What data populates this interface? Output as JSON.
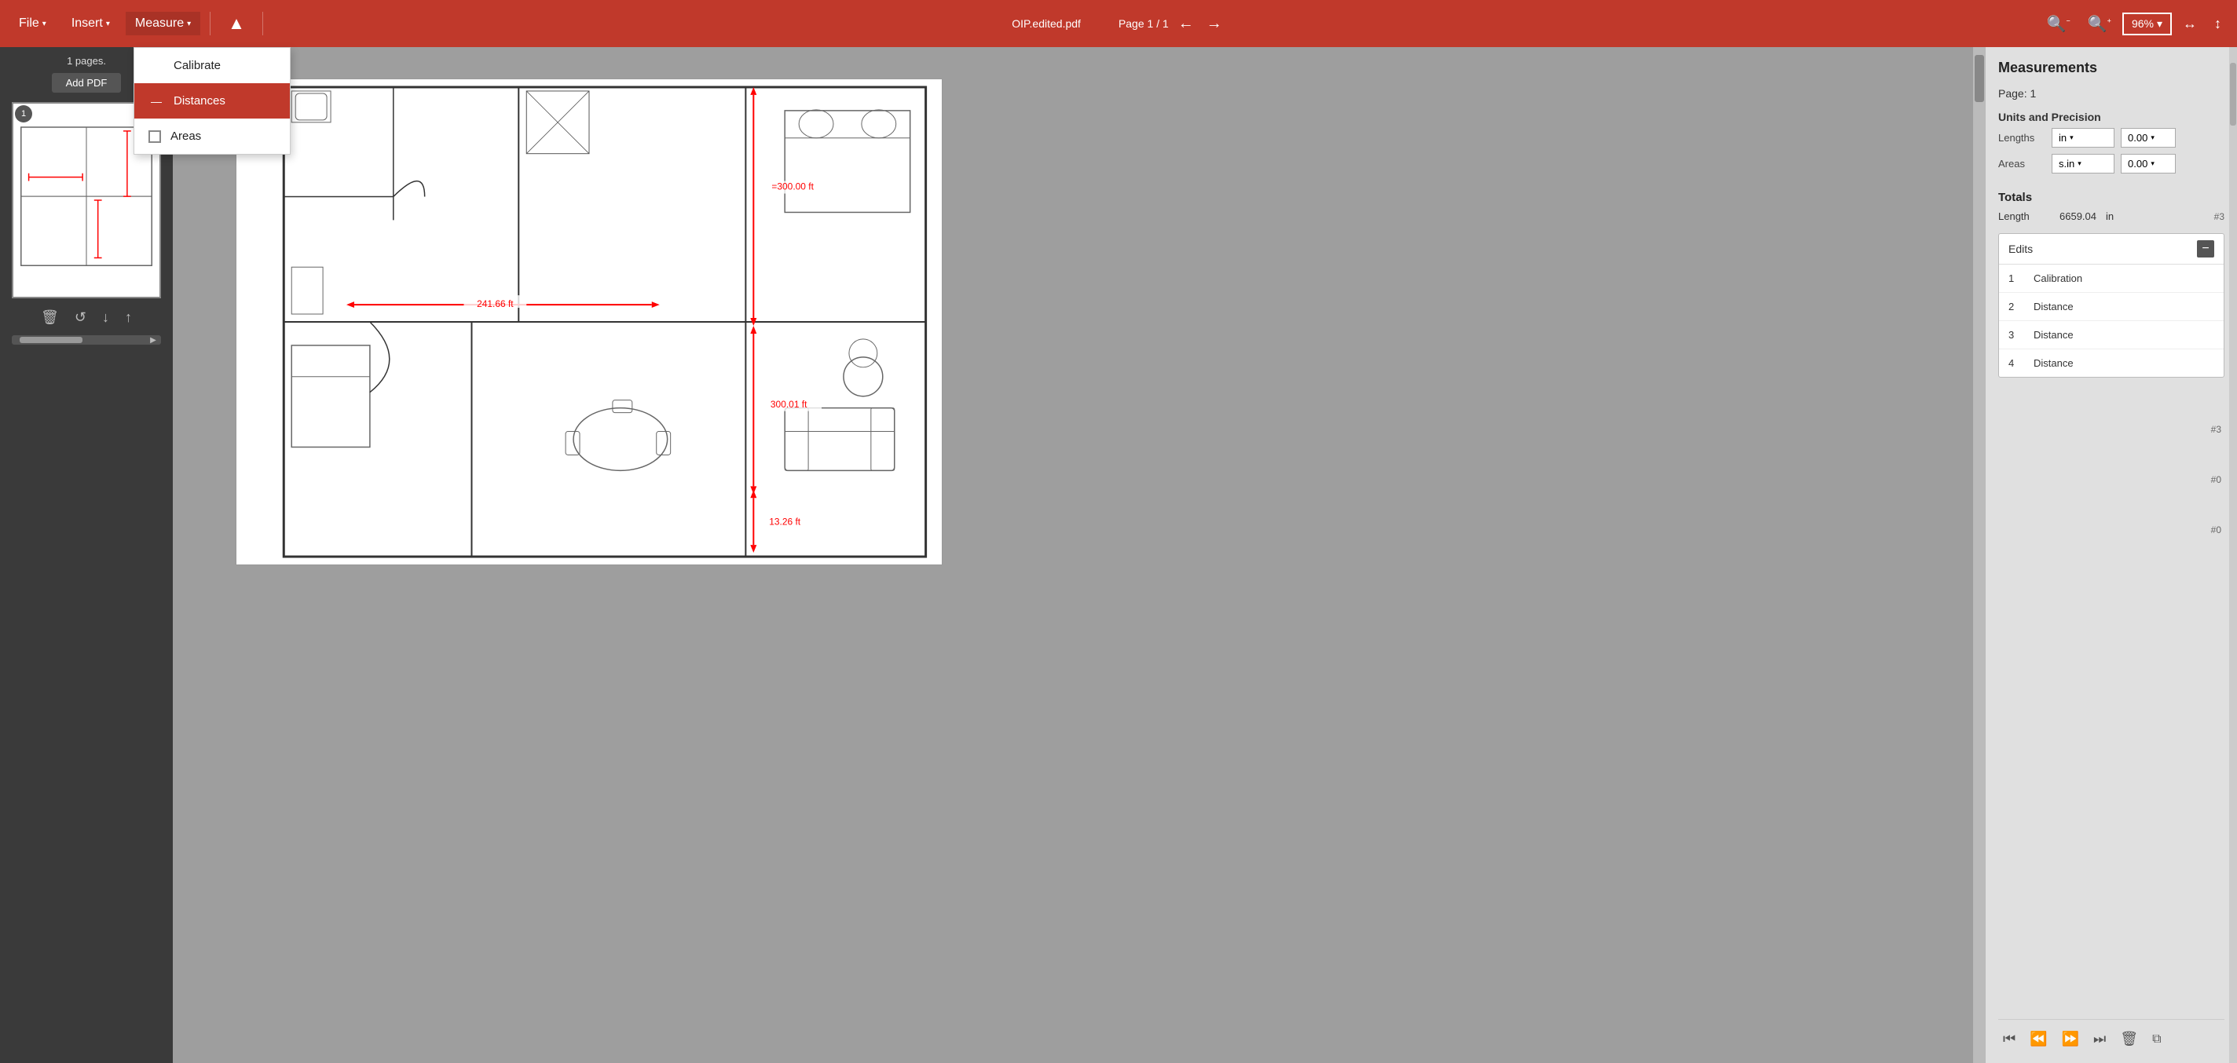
{
  "toolbar": {
    "file_label": "File",
    "insert_label": "Insert",
    "measure_label": "Measure",
    "filename": "OIP.edited.pdf",
    "page_info": "Page 1 / 1",
    "zoom_level": "96%",
    "cursor_icon": "▲"
  },
  "dropdown": {
    "visible": true,
    "calibrate_label": "Calibrate",
    "distances_label": "Distances",
    "areas_label": "Areas",
    "distances_selected": true,
    "areas_checked": false
  },
  "sidebar": {
    "pages_label": "1 pages.",
    "add_pdf_label": "Add PDF",
    "page_number": "1"
  },
  "sidebar_controls": {
    "delete_icon": "🗑",
    "refresh_icon": "↺",
    "down_icon": "↓",
    "up_icon": "↑"
  },
  "canvas": {
    "scroll_visible": true
  },
  "right_panel": {
    "title": "Measurements",
    "page_label": "Page: 1",
    "units_section_title": "Units and Precision",
    "lengths_label": "Lengths",
    "lengths_unit": "in",
    "lengths_precision": "0.00",
    "areas_label": "Areas",
    "areas_unit": "s.in",
    "areas_precision": "0.00",
    "totals_title": "Totals",
    "length_label": "Length",
    "length_value": "6659.04",
    "length_unit": "in",
    "length_count": "#3",
    "edits_label": "Edits",
    "edits_minus": "−",
    "items": [
      {
        "num": "1",
        "type": "Calibration",
        "count": ""
      },
      {
        "num": "2",
        "type": "Distance",
        "count": ""
      },
      {
        "num": "3",
        "type": "Distance",
        "count": ""
      },
      {
        "num": "4",
        "type": "Distance",
        "count": ""
      }
    ],
    "right_count_3": "#0",
    "right_count_4": "#0"
  },
  "panel_bottom": {
    "first_icon": "⏮",
    "prev_icon": "⏪",
    "next_icon": "⏩",
    "last_icon": "⏭",
    "delete_icon": "🗑",
    "copy_icon": "⧉"
  },
  "measurements_on_plan": {
    "h_distance": "241.66 ft",
    "v_distance_top": "=300.00 ft",
    "v_distance_mid": "300.01 ft",
    "v_distance_bot": "13.26 ft"
  }
}
